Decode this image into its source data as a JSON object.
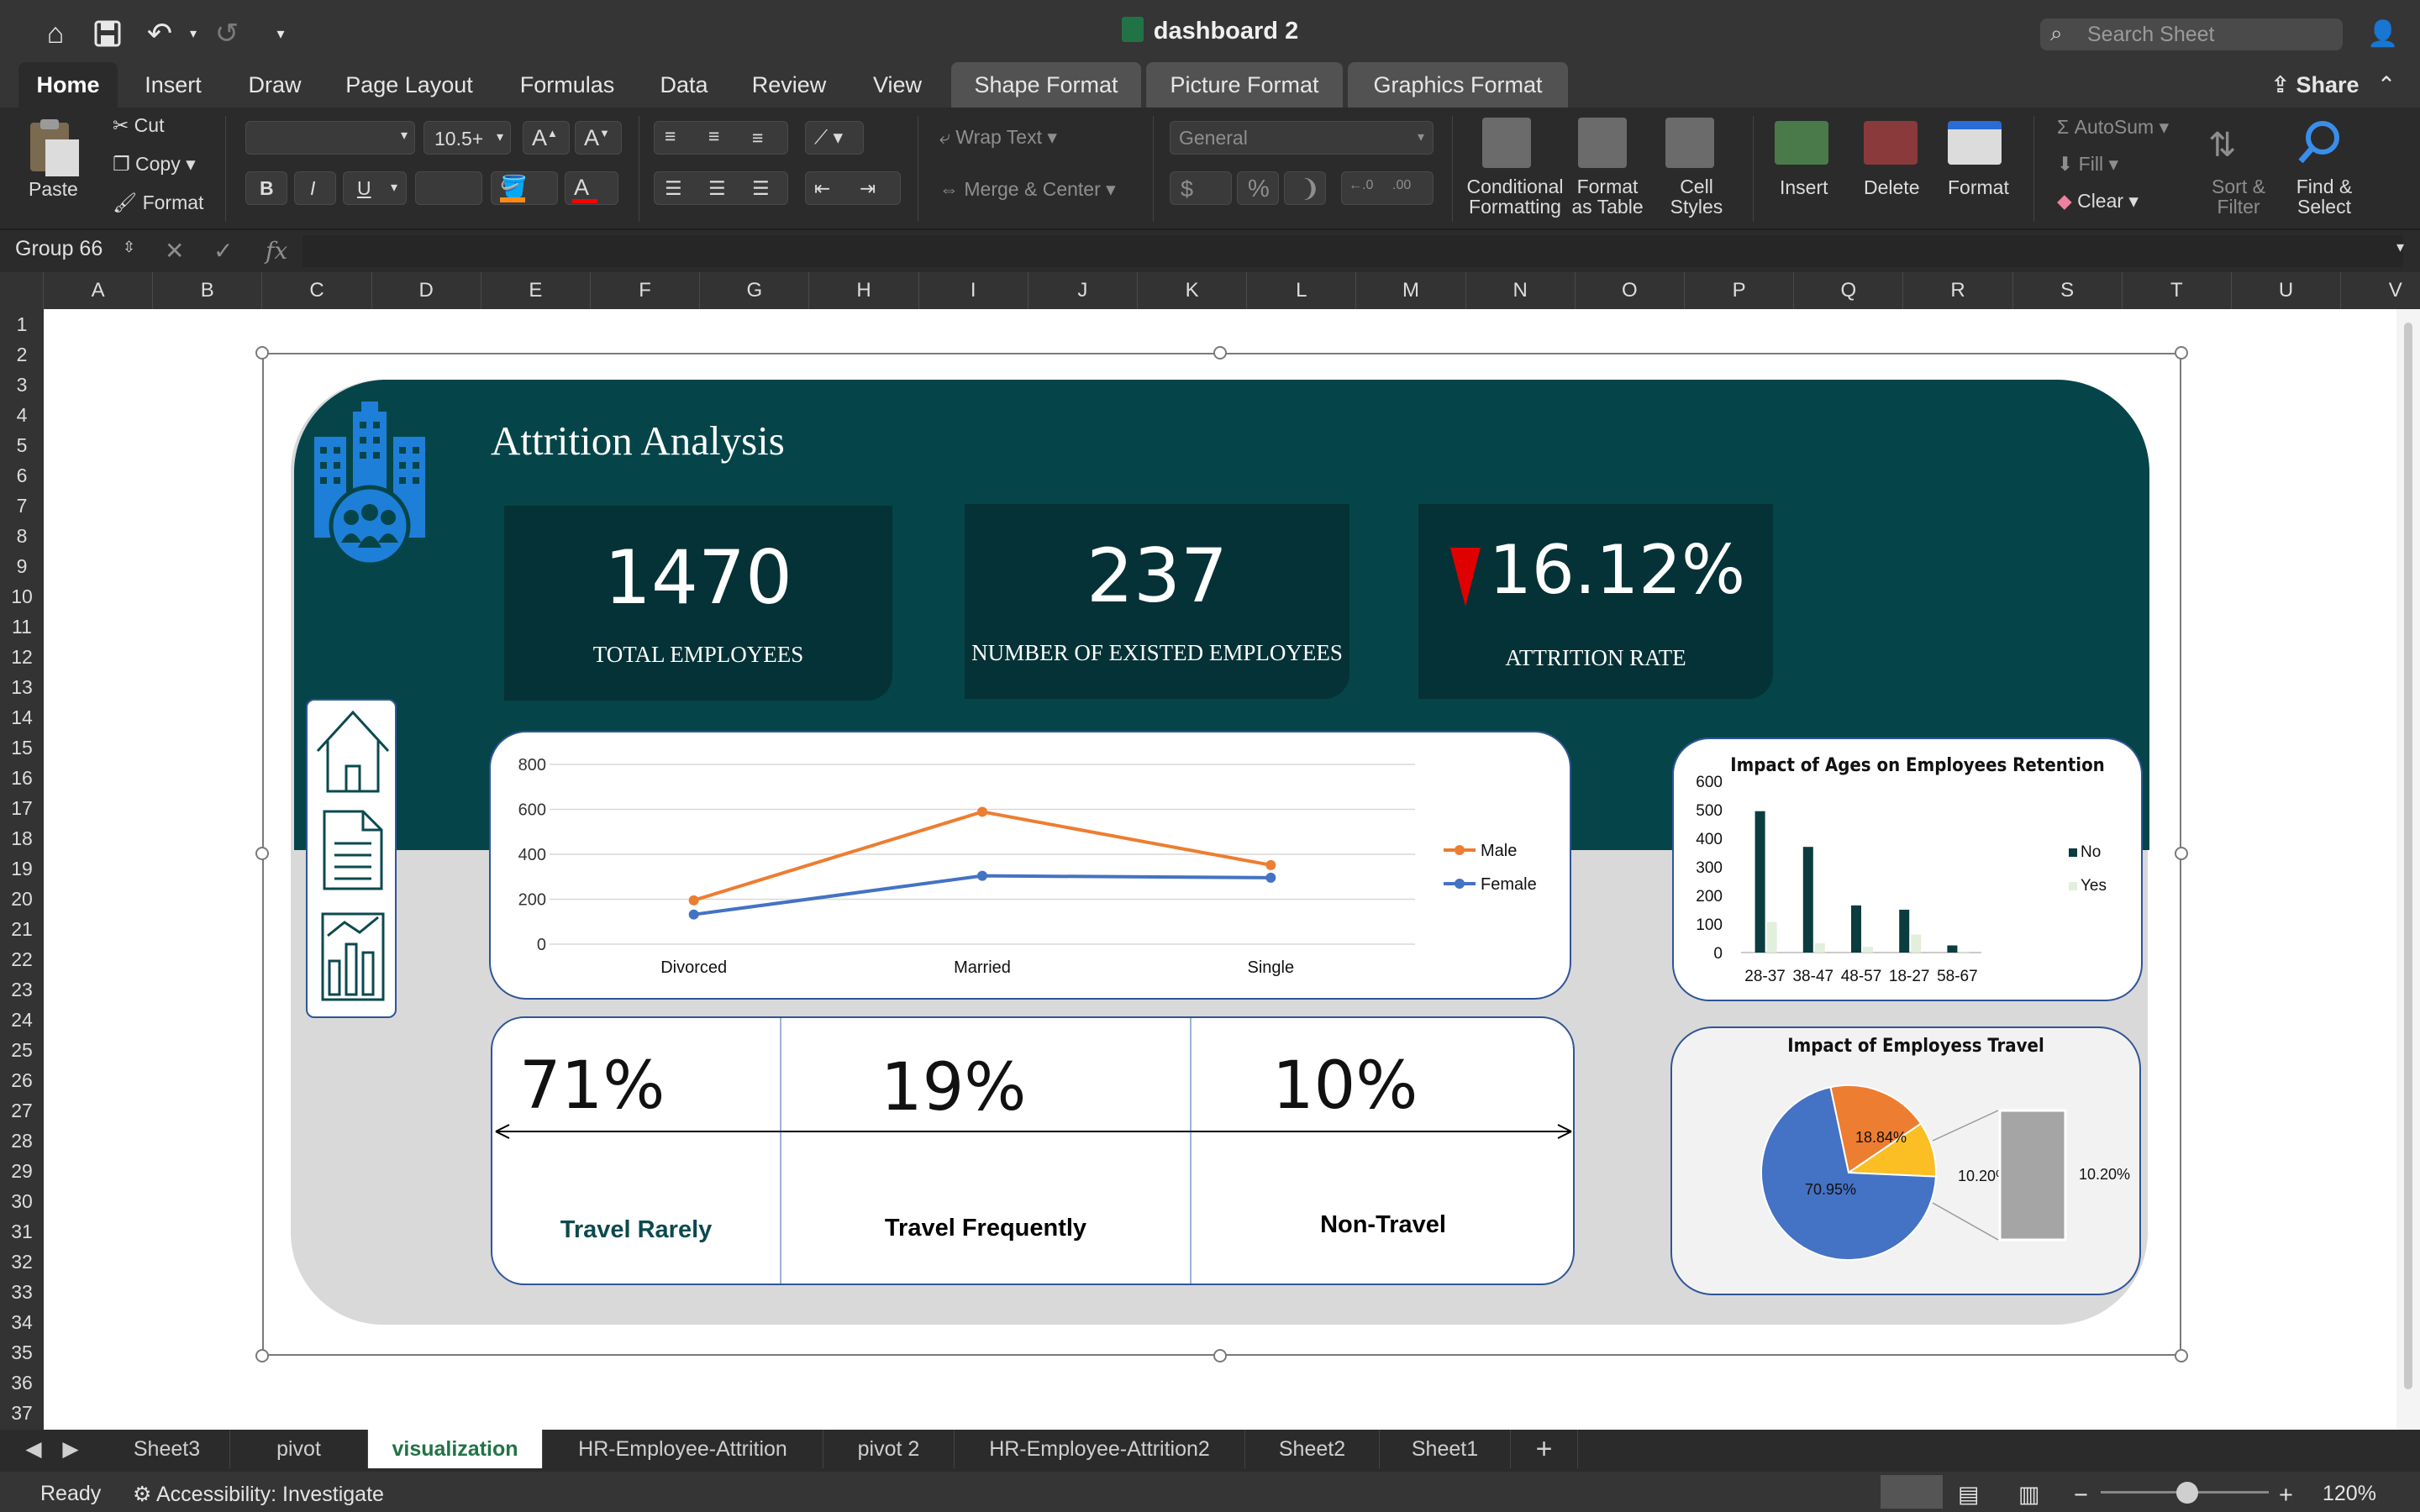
{
  "window": {
    "title": "dashboard 2",
    "search_placeholder": "Search Sheet",
    "share": "Share"
  },
  "tabs": [
    "Home",
    "Insert",
    "Draw",
    "Page Layout",
    "Formulas",
    "Data",
    "Review",
    "View",
    "Shape Format",
    "Picture Format",
    "Graphics Format"
  ],
  "ribbon": {
    "paste": "Paste",
    "cut": "Cut",
    "copy": "Copy",
    "format_painter": "Format",
    "font_size": "10.5+",
    "wrap_text": "Wrap Text",
    "merge_center": "Merge & Center",
    "number_format": "General",
    "conditional_formatting": [
      "Conditional",
      "Formatting"
    ],
    "format_as_table": [
      "Format",
      "as Table"
    ],
    "cell_styles": [
      "Cell",
      "Styles"
    ],
    "insert": "Insert",
    "delete": "Delete",
    "format": "Format",
    "autosum": "AutoSum",
    "fill": "Fill",
    "clear": "Clear",
    "sort_filter": [
      "Sort &",
      "Filter"
    ],
    "find_select": [
      "Find &",
      "Select"
    ],
    "bold": "B",
    "italic": "I",
    "underline": "U",
    "currency": "$",
    "percent": "%"
  },
  "formula_bar": {
    "name_box": "Group 66",
    "fx": "fx",
    "value": ""
  },
  "columns": [
    "A",
    "B",
    "C",
    "D",
    "E",
    "F",
    "G",
    "H",
    "I",
    "J",
    "K",
    "L",
    "M",
    "N",
    "O",
    "P",
    "Q",
    "R",
    "S",
    "T",
    "U",
    "V"
  ],
  "rows": [
    "1",
    "2",
    "3",
    "4",
    "5",
    "6",
    "7",
    "8",
    "9",
    "10",
    "11",
    "12",
    "13",
    "14",
    "15",
    "16",
    "17",
    "18",
    "19",
    "20",
    "21",
    "22",
    "23",
    "24",
    "25",
    "26",
    "27",
    "28",
    "29",
    "30",
    "31",
    "32",
    "33",
    "34",
    "35",
    "36",
    "37"
  ],
  "dashboard": {
    "title": "Attrition Analysis",
    "kpis": [
      {
        "value": "1470",
        "label": "TOTAL EMPLOYEES"
      },
      {
        "value": "237",
        "label": "NUMBER OF EXISTED EMPLOYEES"
      },
      {
        "value": "16.12%",
        "label": "ATTRITION RATE"
      }
    ],
    "travel": [
      {
        "pct": "71%",
        "label": "Travel Rarely",
        "color": "#0b4a4f"
      },
      {
        "pct": "19%",
        "label": "Travel Frequently",
        "color": "#000000"
      },
      {
        "pct": "10%",
        "label": "Non-Travel",
        "color": "#000000"
      }
    ]
  },
  "chart_data": [
    {
      "type": "line",
      "title": "",
      "categories": [
        "Divorced",
        "Married",
        "Single"
      ],
      "series": [
        {
          "name": "Male",
          "values": [
            195,
            589,
            352
          ],
          "color": "#ed7d31"
        },
        {
          "name": "Female",
          "values": [
            132,
            304,
            296
          ],
          "color": "#4472c4"
        }
      ],
      "ylim": [
        0,
        800
      ],
      "yticks": [
        0,
        200,
        400,
        600,
        800
      ],
      "legend": "right",
      "grid": true
    },
    {
      "type": "bar",
      "title": "Impact of Ages on Employees Retention",
      "categories": [
        "28-37",
        "38-47",
        "48-57",
        "18-27",
        "58-67"
      ],
      "series": [
        {
          "name": "No",
          "values": [
            495,
            370,
            165,
            150,
            25
          ],
          "color": "#0b3c40"
        },
        {
          "name": "Yes",
          "values": [
            107,
            33,
            20,
            63,
            4
          ],
          "color": "#e2efda"
        }
      ],
      "ylim": [
        0,
        600
      ],
      "yticks": [
        0,
        100,
        200,
        300,
        400,
        500,
        600
      ],
      "legend": "right"
    },
    {
      "type": "pie",
      "title": "Impact of Employess Travel",
      "slices": [
        {
          "label": "70.95%",
          "value": 70.95,
          "color": "#4472c4"
        },
        {
          "label": "18.84%",
          "value": 18.84,
          "color": "#ed7d31"
        },
        {
          "label": "10.20%",
          "value": 10.2,
          "color": "#fbbf24"
        }
      ],
      "secondary_bar_label": "10.20%",
      "secondary_color": "#a5a5a5"
    }
  ],
  "sheet_tabs": [
    "Sheet3",
    "pivot",
    "visualization",
    "HR-Employee-Attrition",
    "pivot 2",
    "HR-Employee-Attrition2",
    "Sheet2",
    "Sheet1"
  ],
  "active_sheet": "visualization",
  "status": {
    "ready": "Ready",
    "accessibility": "Accessibility: Investigate",
    "zoom": "120%"
  }
}
